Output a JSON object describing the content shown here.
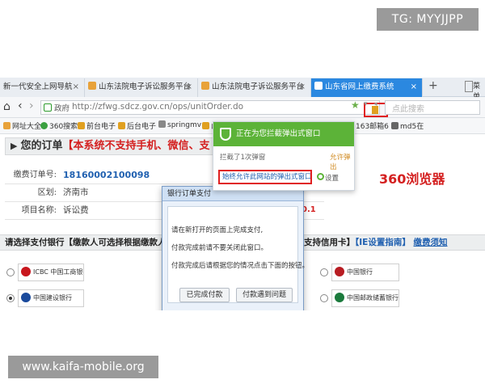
{
  "watermark_top": "TG: MYYJJPP",
  "watermark_bottom": "www.kaifa-mobile.org",
  "browser": {
    "tabs": [
      {
        "label": "新一代安全上网导航",
        "close": "×"
      },
      {
        "label": "山东法院电子诉讼服务平台",
        "close": "×"
      },
      {
        "label": "山东法院电子诉讼服务平台",
        "close": "×"
      },
      {
        "label": "山东省网上缴费系统",
        "close": "×"
      }
    ],
    "new_tab": "+",
    "tab_overflow": "菜单",
    "url_tag": "政府",
    "url": "http://zfwg.sdcz.gov.cn/ops/unitOrder.do",
    "search_placeholder": "点此搜索",
    "bookmarks": [
      "网址大全",
      "360搜索",
      "前台电子",
      "后台电子",
      "springmv",
      "山",
      "163邮箱6",
      "md5在"
    ]
  },
  "page": {
    "order_title_prefix": "您的订单",
    "order_title_notice": "【本系统不支持手机、微信、支",
    "info": [
      {
        "label": "缴费订单号:",
        "value": "18160002100098"
      },
      {
        "label": "区划:",
        "value": "济南市"
      },
      {
        "label": "项目名称:",
        "value": "诉讼费"
      }
    ],
    "value_fragment": "0.1",
    "bank_header_left": "请选择支付银行【缴款人可选择根据缴款人",
    "bank_header_right_prefix": "支持信用卡】",
    "bank_header_link1": "【IE设置指南】",
    "bank_header_link2": "缴费须知",
    "banks": [
      {
        "name": "ICBC 中国工商银行",
        "color": "#c8161d"
      },
      {
        "name": "中国建设银行",
        "color": "#1a4a9c"
      },
      {
        "name": "中国银行",
        "color": "#b81c22"
      },
      {
        "name": "中国邮政储蓄银行",
        "color": "#1b7a3c"
      }
    ]
  },
  "popup_notice": {
    "title": "正在为您拦截弹出式窗口",
    "blocked_count": "拦截了1次弹窗",
    "unblock": "允许弹出",
    "allow_always": "始终允许此网站的弹出式窗口",
    "settings": "设置"
  },
  "annotation": "360浏览器",
  "dialog": {
    "title": "银行订单支付",
    "lines": [
      "请在新打开的页面上完成支付,",
      "付款完成前请不要关闭此窗口。",
      "付款完成后请根据您的情况点击下面的按钮。"
    ],
    "btn_done": "已完成付款",
    "btn_problem": "付款遇到问题"
  },
  "colors": {
    "tab_active": "#2b88e0",
    "notice_green": "#5cb338",
    "alert_red": "#e02020",
    "link_blue": "#2060b0"
  }
}
